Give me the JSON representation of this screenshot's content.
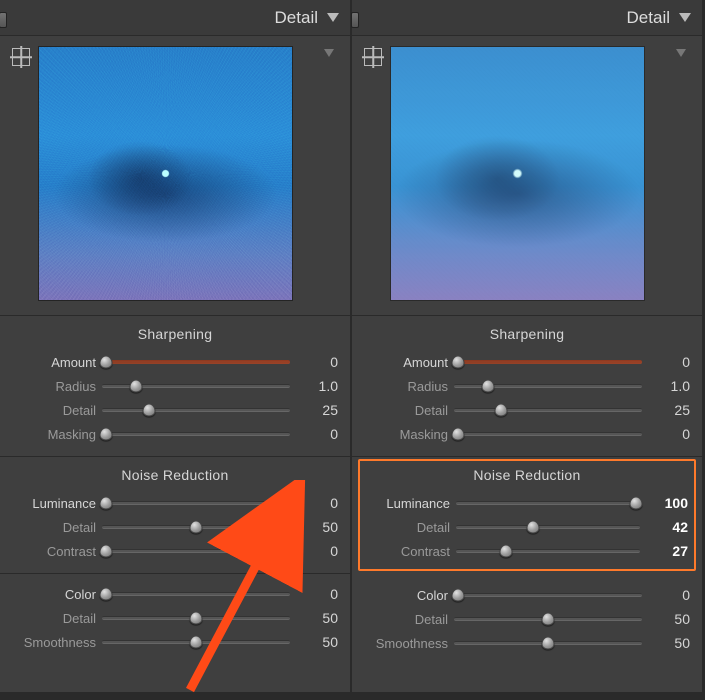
{
  "accentHighlight": "#ff7a2b",
  "panels": [
    {
      "title": "Detail",
      "previewStyle": "noisy",
      "sharpening": {
        "title": "Sharpening",
        "amount": {
          "label": "Amount",
          "value": "0",
          "pos": 2,
          "redDefault": true
        },
        "radius": {
          "label": "Radius",
          "value": "1.0",
          "pos": 18
        },
        "detail": {
          "label": "Detail",
          "value": "25",
          "pos": 25
        },
        "masking": {
          "label": "Masking",
          "value": "0",
          "pos": 2
        }
      },
      "noiseReduction": {
        "title": "Noise Reduction",
        "highlighted": false,
        "luminance": {
          "label": "Luminance",
          "value": "0",
          "pos": 2
        },
        "nrDetail": {
          "label": "Detail",
          "value": "50",
          "pos": 50
        },
        "contrast": {
          "label": "Contrast",
          "value": "0",
          "pos": 2
        }
      },
      "colorNR": {
        "color": {
          "label": "Color",
          "value": "0",
          "pos": 2
        },
        "cDetail": {
          "label": "Detail",
          "value": "50",
          "pos": 50
        },
        "smoothness": {
          "label": "Smoothness",
          "value": "50",
          "pos": 50
        }
      }
    },
    {
      "title": "Detail",
      "previewStyle": "smooth",
      "sharpening": {
        "title": "Sharpening",
        "amount": {
          "label": "Amount",
          "value": "0",
          "pos": 2,
          "redDefault": true
        },
        "radius": {
          "label": "Radius",
          "value": "1.0",
          "pos": 18
        },
        "detail": {
          "label": "Detail",
          "value": "25",
          "pos": 25
        },
        "masking": {
          "label": "Masking",
          "value": "0",
          "pos": 2
        }
      },
      "noiseReduction": {
        "title": "Noise Reduction",
        "highlighted": true,
        "luminance": {
          "label": "Luminance",
          "value": "100",
          "pos": 98
        },
        "nrDetail": {
          "label": "Detail",
          "value": "42",
          "pos": 42
        },
        "contrast": {
          "label": "Contrast",
          "value": "27",
          "pos": 27
        }
      },
      "colorNR": {
        "color": {
          "label": "Color",
          "value": "0",
          "pos": 2
        },
        "cDetail": {
          "label": "Detail",
          "value": "50",
          "pos": 50
        },
        "smoothness": {
          "label": "Smoothness",
          "value": "50",
          "pos": 50
        }
      }
    }
  ]
}
